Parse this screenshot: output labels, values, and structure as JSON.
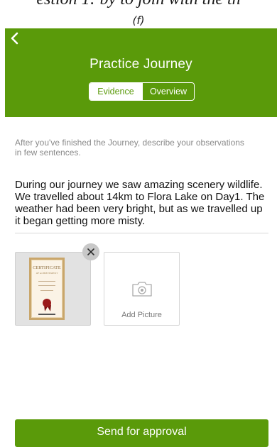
{
  "caption": {
    "partial_text": "estion 1: by to join with the th",
    "label": "(f)"
  },
  "header": {
    "back_icon": "chevron-left-icon",
    "title": "Practice Journey",
    "tabs": [
      {
        "label": "Evidence",
        "active": true
      },
      {
        "label": "Overview",
        "active": false
      }
    ]
  },
  "content": {
    "instructions": "After you've finished the Journey, describe your observations in few sentences.",
    "observations": "During our journey we saw amazing scenery wildlife. We travelled about 14km to Flora Lake on Day1. The weather had been very bright, but as we travelled up it began getting more misty."
  },
  "attachments": {
    "certificate_title": "CERTIFICATE",
    "certificate_subtitle": "OF ACHIEVEMENT",
    "remove_icon": "close-icon",
    "add_icon": "camera-icon",
    "add_label": "Add Picture"
  },
  "footer": {
    "send_label": "Send for approval"
  },
  "colors": {
    "accent": "#5a9a0a",
    "text_muted": "#8a8a8a"
  }
}
